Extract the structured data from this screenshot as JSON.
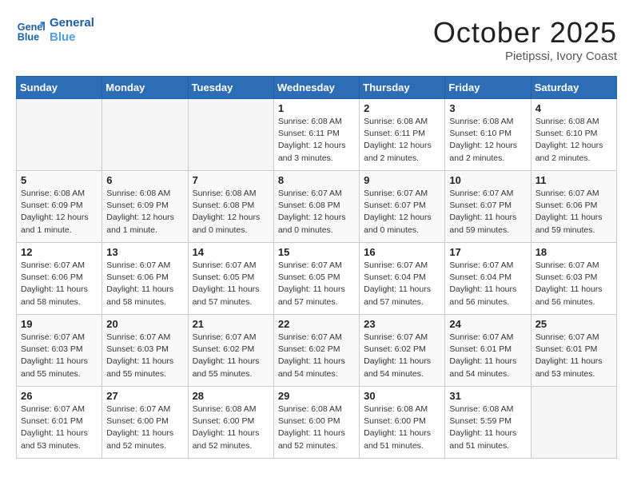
{
  "header": {
    "logo_line1": "General",
    "logo_line2": "Blue",
    "month": "October 2025",
    "location": "Pietipssi, Ivory Coast"
  },
  "days_of_week": [
    "Sunday",
    "Monday",
    "Tuesday",
    "Wednesday",
    "Thursday",
    "Friday",
    "Saturday"
  ],
  "weeks": [
    [
      {
        "day": "",
        "info": ""
      },
      {
        "day": "",
        "info": ""
      },
      {
        "day": "",
        "info": ""
      },
      {
        "day": "1",
        "info": "Sunrise: 6:08 AM\nSunset: 6:11 PM\nDaylight: 12 hours and 3 minutes."
      },
      {
        "day": "2",
        "info": "Sunrise: 6:08 AM\nSunset: 6:11 PM\nDaylight: 12 hours and 2 minutes."
      },
      {
        "day": "3",
        "info": "Sunrise: 6:08 AM\nSunset: 6:10 PM\nDaylight: 12 hours and 2 minutes."
      },
      {
        "day": "4",
        "info": "Sunrise: 6:08 AM\nSunset: 6:10 PM\nDaylight: 12 hours and 2 minutes."
      }
    ],
    [
      {
        "day": "5",
        "info": "Sunrise: 6:08 AM\nSunset: 6:09 PM\nDaylight: 12 hours and 1 minute."
      },
      {
        "day": "6",
        "info": "Sunrise: 6:08 AM\nSunset: 6:09 PM\nDaylight: 12 hours and 1 minute."
      },
      {
        "day": "7",
        "info": "Sunrise: 6:08 AM\nSunset: 6:08 PM\nDaylight: 12 hours and 0 minutes."
      },
      {
        "day": "8",
        "info": "Sunrise: 6:07 AM\nSunset: 6:08 PM\nDaylight: 12 hours and 0 minutes."
      },
      {
        "day": "9",
        "info": "Sunrise: 6:07 AM\nSunset: 6:07 PM\nDaylight: 12 hours and 0 minutes."
      },
      {
        "day": "10",
        "info": "Sunrise: 6:07 AM\nSunset: 6:07 PM\nDaylight: 11 hours and 59 minutes."
      },
      {
        "day": "11",
        "info": "Sunrise: 6:07 AM\nSunset: 6:06 PM\nDaylight: 11 hours and 59 minutes."
      }
    ],
    [
      {
        "day": "12",
        "info": "Sunrise: 6:07 AM\nSunset: 6:06 PM\nDaylight: 11 hours and 58 minutes."
      },
      {
        "day": "13",
        "info": "Sunrise: 6:07 AM\nSunset: 6:06 PM\nDaylight: 11 hours and 58 minutes."
      },
      {
        "day": "14",
        "info": "Sunrise: 6:07 AM\nSunset: 6:05 PM\nDaylight: 11 hours and 57 minutes."
      },
      {
        "day": "15",
        "info": "Sunrise: 6:07 AM\nSunset: 6:05 PM\nDaylight: 11 hours and 57 minutes."
      },
      {
        "day": "16",
        "info": "Sunrise: 6:07 AM\nSunset: 6:04 PM\nDaylight: 11 hours and 57 minutes."
      },
      {
        "day": "17",
        "info": "Sunrise: 6:07 AM\nSunset: 6:04 PM\nDaylight: 11 hours and 56 minutes."
      },
      {
        "day": "18",
        "info": "Sunrise: 6:07 AM\nSunset: 6:03 PM\nDaylight: 11 hours and 56 minutes."
      }
    ],
    [
      {
        "day": "19",
        "info": "Sunrise: 6:07 AM\nSunset: 6:03 PM\nDaylight: 11 hours and 55 minutes."
      },
      {
        "day": "20",
        "info": "Sunrise: 6:07 AM\nSunset: 6:03 PM\nDaylight: 11 hours and 55 minutes."
      },
      {
        "day": "21",
        "info": "Sunrise: 6:07 AM\nSunset: 6:02 PM\nDaylight: 11 hours and 55 minutes."
      },
      {
        "day": "22",
        "info": "Sunrise: 6:07 AM\nSunset: 6:02 PM\nDaylight: 11 hours and 54 minutes."
      },
      {
        "day": "23",
        "info": "Sunrise: 6:07 AM\nSunset: 6:02 PM\nDaylight: 11 hours and 54 minutes."
      },
      {
        "day": "24",
        "info": "Sunrise: 6:07 AM\nSunset: 6:01 PM\nDaylight: 11 hours and 54 minutes."
      },
      {
        "day": "25",
        "info": "Sunrise: 6:07 AM\nSunset: 6:01 PM\nDaylight: 11 hours and 53 minutes."
      }
    ],
    [
      {
        "day": "26",
        "info": "Sunrise: 6:07 AM\nSunset: 6:01 PM\nDaylight: 11 hours and 53 minutes."
      },
      {
        "day": "27",
        "info": "Sunrise: 6:07 AM\nSunset: 6:00 PM\nDaylight: 11 hours and 52 minutes."
      },
      {
        "day": "28",
        "info": "Sunrise: 6:08 AM\nSunset: 6:00 PM\nDaylight: 11 hours and 52 minutes."
      },
      {
        "day": "29",
        "info": "Sunrise: 6:08 AM\nSunset: 6:00 PM\nDaylight: 11 hours and 52 minutes."
      },
      {
        "day": "30",
        "info": "Sunrise: 6:08 AM\nSunset: 6:00 PM\nDaylight: 11 hours and 51 minutes."
      },
      {
        "day": "31",
        "info": "Sunrise: 6:08 AM\nSunset: 5:59 PM\nDaylight: 11 hours and 51 minutes."
      },
      {
        "day": "",
        "info": ""
      }
    ]
  ]
}
